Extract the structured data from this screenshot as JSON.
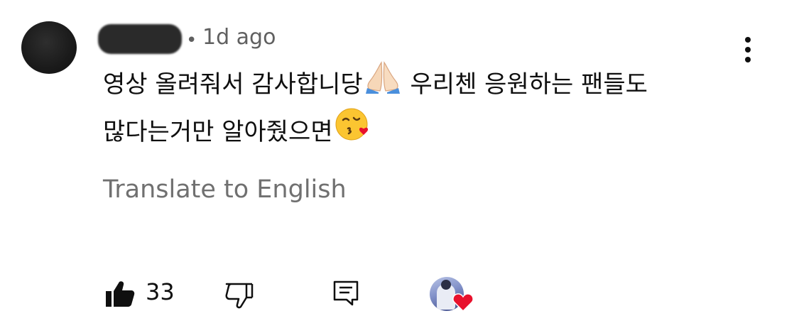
{
  "comment": {
    "author_name": "",
    "timestamp": "1d ago",
    "text_part1": "영상 올려줘서 감사합니당",
    "text_part2": " 우리첸  응원하는 팬들도 많다는거만 알아줬으면",
    "emoji_1": "folded-hands-emoji",
    "emoji_2": "face-blowing-kiss-emoji",
    "translate_label": "Translate to English"
  },
  "actions": {
    "like_count": "33",
    "like_icon": "thumbs-up-icon",
    "dislike_icon": "thumbs-down-icon",
    "reply_icon": "reply-icon",
    "creator_heart": "creator-heart-badge"
  },
  "colors": {
    "text_primary": "#0f0f0f",
    "text_secondary": "#606060",
    "heart": "#e8112d"
  }
}
